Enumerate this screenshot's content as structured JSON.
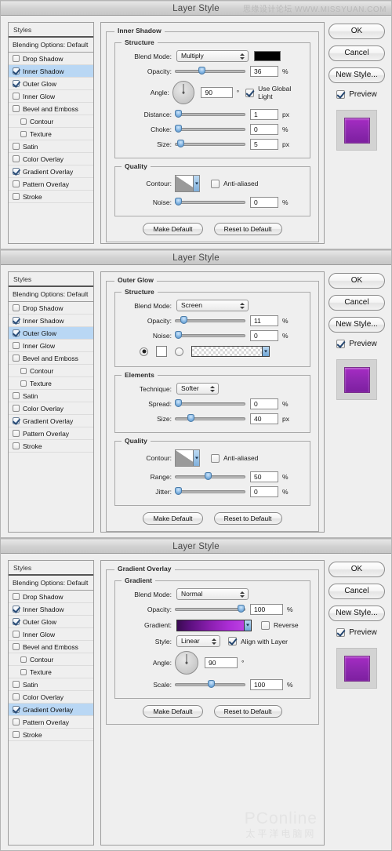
{
  "window": {
    "title": "Layer Style"
  },
  "watermarks": {
    "top": "思缘设计论坛 WWW.MISSYUAN.COM",
    "bottom_line1": "PConline",
    "bottom_line2": "太平洋电脑网"
  },
  "styles_panel": {
    "header": "Styles",
    "blending_options": "Blending Options: Default",
    "items": [
      {
        "label": "Drop Shadow",
        "checked": false,
        "indent": false
      },
      {
        "label": "Inner Shadow",
        "checked": true,
        "indent": false
      },
      {
        "label": "Outer Glow",
        "checked": true,
        "indent": false
      },
      {
        "label": "Inner Glow",
        "checked": false,
        "indent": false
      },
      {
        "label": "Bevel and Emboss",
        "checked": false,
        "indent": false
      },
      {
        "label": "Contour",
        "checked": false,
        "indent": true
      },
      {
        "label": "Texture",
        "checked": false,
        "indent": true
      },
      {
        "label": "Satin",
        "checked": false,
        "indent": false
      },
      {
        "label": "Color Overlay",
        "checked": false,
        "indent": false
      },
      {
        "label": "Gradient Overlay",
        "checked": true,
        "indent": false
      },
      {
        "label": "Pattern Overlay",
        "checked": false,
        "indent": false
      },
      {
        "label": "Stroke",
        "checked": false,
        "indent": false
      }
    ]
  },
  "buttons": {
    "ok": "OK",
    "cancel": "Cancel",
    "new_style": "New Style...",
    "preview": "Preview",
    "make_default": "Make Default",
    "reset_to_default": "Reset to Default"
  },
  "labels": {
    "blend_mode": "Blend Mode:",
    "opacity": "Opacity:",
    "angle": "Angle:",
    "distance": "Distance:",
    "choke": "Choke:",
    "size": "Size:",
    "contour": "Contour:",
    "noise": "Noise:",
    "technique": "Technique:",
    "spread": "Spread:",
    "range": "Range:",
    "jitter": "Jitter:",
    "gradient": "Gradient:",
    "style": "Style:",
    "scale": "Scale:",
    "use_global_light": "Use Global Light",
    "anti_aliased": "Anti-aliased",
    "reverse": "Reverse",
    "align_with_layer": "Align with Layer",
    "pct": "%",
    "px": "px",
    "deg": "°"
  },
  "panel1": {
    "selected_style": "Inner Shadow",
    "legend": "Inner Shadow",
    "group_structure": "Structure",
    "group_quality": "Quality",
    "blend_mode_value": "Multiply",
    "color_swatch": "#000000",
    "opacity": "36",
    "angle": "90",
    "use_global_light": true,
    "distance": "1",
    "choke": "0",
    "size": "5",
    "anti_aliased": false,
    "noise": "0"
  },
  "panel2": {
    "selected_style": "Outer Glow",
    "legend": "Outer Glow",
    "group_structure": "Structure",
    "group_elements": "Elements",
    "group_quality": "Quality",
    "blend_mode_value": "Screen",
    "opacity": "11",
    "noise": "0",
    "fill_type_solid_selected": true,
    "solid_color": "#ffffff",
    "technique_value": "Softer",
    "spread": "0",
    "size": "40",
    "anti_aliased": false,
    "range": "50",
    "jitter": "0"
  },
  "panel3": {
    "selected_style": "Gradient Overlay",
    "legend": "Gradient Overlay",
    "group_gradient": "Gradient",
    "blend_mode_value": "Normal",
    "opacity": "100",
    "gradient_colors": "#3a0a52 → #c24ae8",
    "reverse": false,
    "style_value": "Linear",
    "align_with_layer": true,
    "angle": "90",
    "scale": "100"
  },
  "preview_swatch_color": "#9a28bb",
  "highlight_color": "#b9d7f4"
}
